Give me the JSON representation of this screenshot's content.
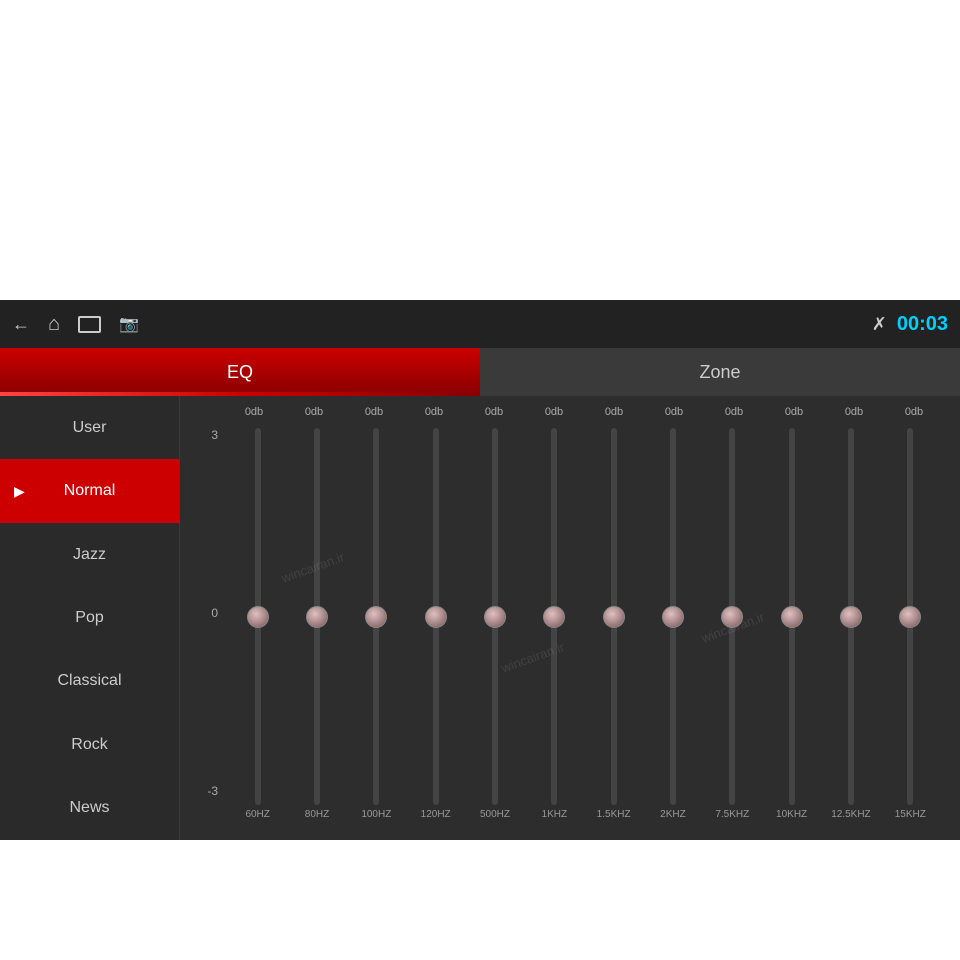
{
  "topbar": {
    "time": "00:03",
    "icons": {
      "back": "⬅",
      "home": "⌂",
      "window": "▭",
      "image": "🖼"
    }
  },
  "tabs": [
    {
      "id": "eq",
      "label": "EQ",
      "active": true
    },
    {
      "id": "zone",
      "label": "Zone",
      "active": false
    }
  ],
  "sidebar": {
    "items": [
      {
        "id": "user",
        "label": "User",
        "active": false
      },
      {
        "id": "normal",
        "label": "Normal",
        "active": true
      },
      {
        "id": "jazz",
        "label": "Jazz",
        "active": false
      },
      {
        "id": "pop",
        "label": "Pop",
        "active": false
      },
      {
        "id": "classical",
        "label": "Classical",
        "active": false
      },
      {
        "id": "rock",
        "label": "Rock",
        "active": false
      },
      {
        "id": "news",
        "label": "News",
        "active": false
      }
    ]
  },
  "eq": {
    "scale": {
      "top": "3",
      "mid": "0",
      "bot": "-3"
    },
    "bands": [
      {
        "freq": "60HZ",
        "db": "0db",
        "value": 0
      },
      {
        "freq": "80HZ",
        "db": "0db",
        "value": 0
      },
      {
        "freq": "100HZ",
        "db": "0db",
        "value": 0
      },
      {
        "freq": "120HZ",
        "db": "0db",
        "value": 0
      },
      {
        "freq": "500HZ",
        "db": "0db",
        "value": 0
      },
      {
        "freq": "1KHZ",
        "db": "0db",
        "value": 0
      },
      {
        "freq": "1.5KHZ",
        "db": "0db",
        "value": 0
      },
      {
        "freq": "2KHZ",
        "db": "0db",
        "value": 0
      },
      {
        "freq": "7.5KHZ",
        "db": "0db",
        "value": 0
      },
      {
        "freq": "10KHZ",
        "db": "0db",
        "value": 0
      },
      {
        "freq": "12.5KHZ",
        "db": "0db",
        "value": 0
      },
      {
        "freq": "15KHZ",
        "db": "0db",
        "value": 0
      }
    ]
  }
}
